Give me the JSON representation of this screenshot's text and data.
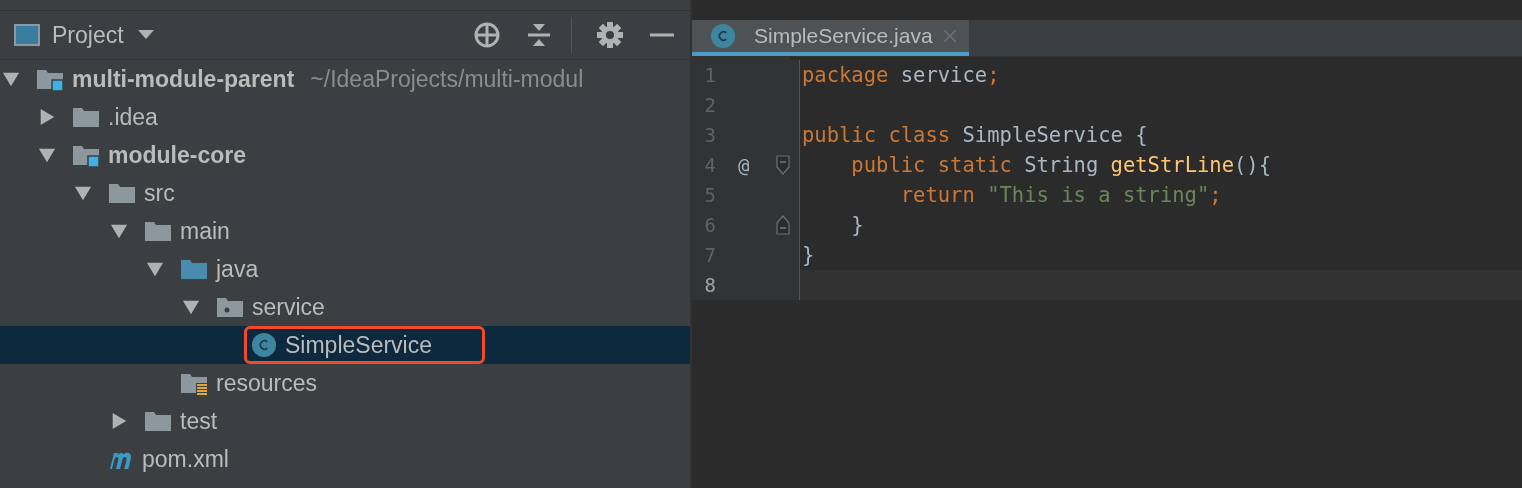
{
  "project_panel": {
    "title": "Project",
    "tree": [
      {
        "name": "multi-module-parent",
        "hint": "~/IdeaProjects/multi-modul",
        "kind": "module",
        "bold": true,
        "expanded": true,
        "selected": false,
        "highlighted": false,
        "children": [
          {
            "name": ".idea",
            "kind": "folder",
            "bold": false,
            "expanded": false,
            "selected": false,
            "highlighted": false
          },
          {
            "name": "module-core",
            "kind": "module",
            "bold": true,
            "expanded": true,
            "selected": false,
            "highlighted": false,
            "children": [
              {
                "name": "src",
                "kind": "folder",
                "bold": false,
                "expanded": true,
                "selected": false,
                "highlighted": false,
                "children": [
                  {
                    "name": "main",
                    "kind": "folder",
                    "bold": false,
                    "expanded": true,
                    "selected": false,
                    "highlighted": false,
                    "children": [
                      {
                        "name": "java",
                        "kind": "source",
                        "bold": false,
                        "expanded": true,
                        "selected": false,
                        "highlighted": false,
                        "children": [
                          {
                            "name": "service",
                            "kind": "package",
                            "bold": false,
                            "expanded": true,
                            "selected": false,
                            "highlighted": false,
                            "children": [
                              {
                                "name": "SimpleService",
                                "kind": "class",
                                "bold": false,
                                "selected": true,
                                "highlighted": true
                              }
                            ]
                          }
                        ]
                      },
                      {
                        "name": "resources",
                        "kind": "resources",
                        "bold": false,
                        "selected": false,
                        "highlighted": false
                      }
                    ]
                  },
                  {
                    "name": "test",
                    "kind": "folder",
                    "bold": false,
                    "expanded": false,
                    "selected": false,
                    "highlighted": false
                  }
                ]
              },
              {
                "name": "pom.xml",
                "kind": "maven",
                "bold": false,
                "selected": false,
                "highlighted": false
              }
            ]
          }
        ]
      }
    ]
  },
  "editor": {
    "tabs": [
      {
        "label": "SimpleService.java",
        "selected": true
      }
    ],
    "lines": [
      {
        "number": "1",
        "tokens": [
          {
            "kind": "keyword",
            "text": "package "
          },
          {
            "kind": "plain",
            "text": "service"
          },
          {
            "kind": "keyword",
            "text": ";"
          }
        ]
      },
      {
        "number": "2"
      },
      {
        "number": "3",
        "tokens": [
          {
            "kind": "keyword",
            "text": "public class "
          },
          {
            "kind": "plain",
            "text": "SimpleService {"
          }
        ]
      },
      {
        "number": "4",
        "marker": "@",
        "fold_start": true,
        "tokens": [
          {
            "kind": "keyword",
            "text": "    public static "
          },
          {
            "kind": "plain",
            "text": "String "
          },
          {
            "kind": "method",
            "text": "getStrLine"
          },
          {
            "kind": "plain",
            "text": "(){"
          }
        ]
      },
      {
        "number": "5",
        "tokens": [
          {
            "kind": "keyword",
            "text": "        return "
          },
          {
            "kind": "string",
            "text": "\"This is a string\""
          },
          {
            "kind": "keyword",
            "text": ";"
          }
        ]
      },
      {
        "number": "6",
        "fold_end": true,
        "tokens": [
          {
            "kind": "plain",
            "text": "    }"
          }
        ]
      },
      {
        "number": "7",
        "tokens": [
          {
            "kind": "plain",
            "text": "}"
          }
        ]
      },
      {
        "number": "8",
        "current": true
      }
    ]
  }
}
